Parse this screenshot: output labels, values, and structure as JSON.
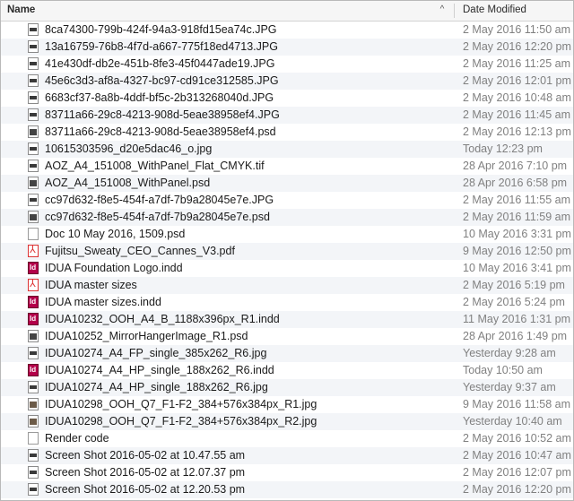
{
  "header": {
    "name_label": "Name",
    "sort_indicator": "^",
    "date_label": "Date Modified"
  },
  "files": [
    {
      "name": "8ca74300-799b-424f-94a3-918fd15ea74c.JPG",
      "date": "2 May 2016 11:50 am",
      "icon": "image-file-icon"
    },
    {
      "name": "13a16759-76b8-4f7d-a667-775f18ed4713.JPG",
      "date": "2 May 2016 12:20 pm",
      "icon": "image-file-icon"
    },
    {
      "name": "41e430df-db2e-451b-8fe3-45f0447ade19.JPG",
      "date": "2 May 2016 11:25 am",
      "icon": "image-file-icon"
    },
    {
      "name": "45e6c3d3-af8a-4327-bc97-cd91ce312585.JPG",
      "date": "2 May 2016 12:01 pm",
      "icon": "image-file-icon"
    },
    {
      "name": "6683cf37-8a8b-4ddf-bf5c-2b313268040d.JPG",
      "date": "2 May 2016 10:48 am",
      "icon": "image-file-icon"
    },
    {
      "name": "83711a66-29c8-4213-908d-5eae38958ef4.JPG",
      "date": "2 May 2016 11:45 am",
      "icon": "image-file-icon"
    },
    {
      "name": "83711a66-29c8-4213-908d-5eae38958ef4.psd",
      "date": "2 May 2016 12:13 pm",
      "icon": "psd-file-icon"
    },
    {
      "name": "10615303596_d20e5dac46_o.jpg",
      "date": "Today 12:23 pm",
      "icon": "image-file-icon"
    },
    {
      "name": "AOZ_A4_151008_WithPanel_Flat_CMYK.tif",
      "date": "28 Apr 2016 7:10 pm",
      "icon": "image-file-icon"
    },
    {
      "name": "AOZ_A4_151008_WithPanel.psd",
      "date": "28 Apr 2016 6:58 pm",
      "icon": "psd-file-icon"
    },
    {
      "name": "cc97d632-f8e5-454f-a7df-7b9a28045e7e.JPG",
      "date": "2 May 2016 11:55 am",
      "icon": "image-file-icon"
    },
    {
      "name": "cc97d632-f8e5-454f-a7df-7b9a28045e7e.psd",
      "date": "2 May 2016 11:59 am",
      "icon": "psd-file-icon"
    },
    {
      "name": "Doc 10 May 2016, 1509.psd",
      "date": "10 May 2016 3:31 pm",
      "icon": "document-file-icon"
    },
    {
      "name": "Fujitsu_Sweaty_CEO_Cannes_V3.pdf",
      "date": "9 May 2016 12:50 pm",
      "icon": "pdf-file-icon"
    },
    {
      "name": "IDUA Foundation Logo.indd",
      "date": "10 May 2016 3:41 pm",
      "icon": "indesign-file-icon"
    },
    {
      "name": "IDUA master sizes",
      "date": "2 May 2016 5:19 pm",
      "icon": "pdf-file-icon"
    },
    {
      "name": "IDUA master sizes.indd",
      "date": "2 May 2016 5:24 pm",
      "icon": "indesign-file-icon"
    },
    {
      "name": "IDUA10232_OOH_A4_B_1188x396px_R1.indd",
      "date": "11 May 2016 1:31 pm",
      "icon": "indesign-file-icon"
    },
    {
      "name": "IDUA10252_MirrorHangerImage_R1.psd",
      "date": "28 Apr 2016 1:49 pm",
      "icon": "psd-file-icon"
    },
    {
      "name": "IDUA10274_A4_FP_single_385x262_R6.jpg",
      "date": "Yesterday 9:28 am",
      "icon": "image-file-icon"
    },
    {
      "name": "IDUA10274_A4_HP_single_188x262_R6.indd",
      "date": "Today 10:50 am",
      "icon": "indesign-file-icon"
    },
    {
      "name": "IDUA10274_A4_HP_single_188x262_R6.jpg",
      "date": "Yesterday 9:37 am",
      "icon": "image-file-icon"
    },
    {
      "name": "IDUA10298_OOH_Q7_F1-F2_384+576x384px_R1.jpg",
      "date": "9 May 2016 11:58 am",
      "icon": "photo-file-icon"
    },
    {
      "name": "IDUA10298_OOH_Q7_F1-F2_384+576x384px_R2.jpg",
      "date": "Yesterday 10:40 am",
      "icon": "photo-file-icon"
    },
    {
      "name": "Render code",
      "date": "2 May 2016 10:52 am",
      "icon": "document-file-icon"
    },
    {
      "name": "Screen Shot 2016-05-02 at 10.47.55 am",
      "date": "2 May 2016 10:47 am",
      "icon": "image-file-icon"
    },
    {
      "name": "Screen Shot 2016-05-02 at 12.07.37 pm",
      "date": "2 May 2016 12:07 pm",
      "icon": "image-file-icon"
    },
    {
      "name": "Screen Shot 2016-05-02 at 12.20.53 pm",
      "date": "2 May 2016 12:20 pm",
      "icon": "image-file-icon"
    }
  ]
}
